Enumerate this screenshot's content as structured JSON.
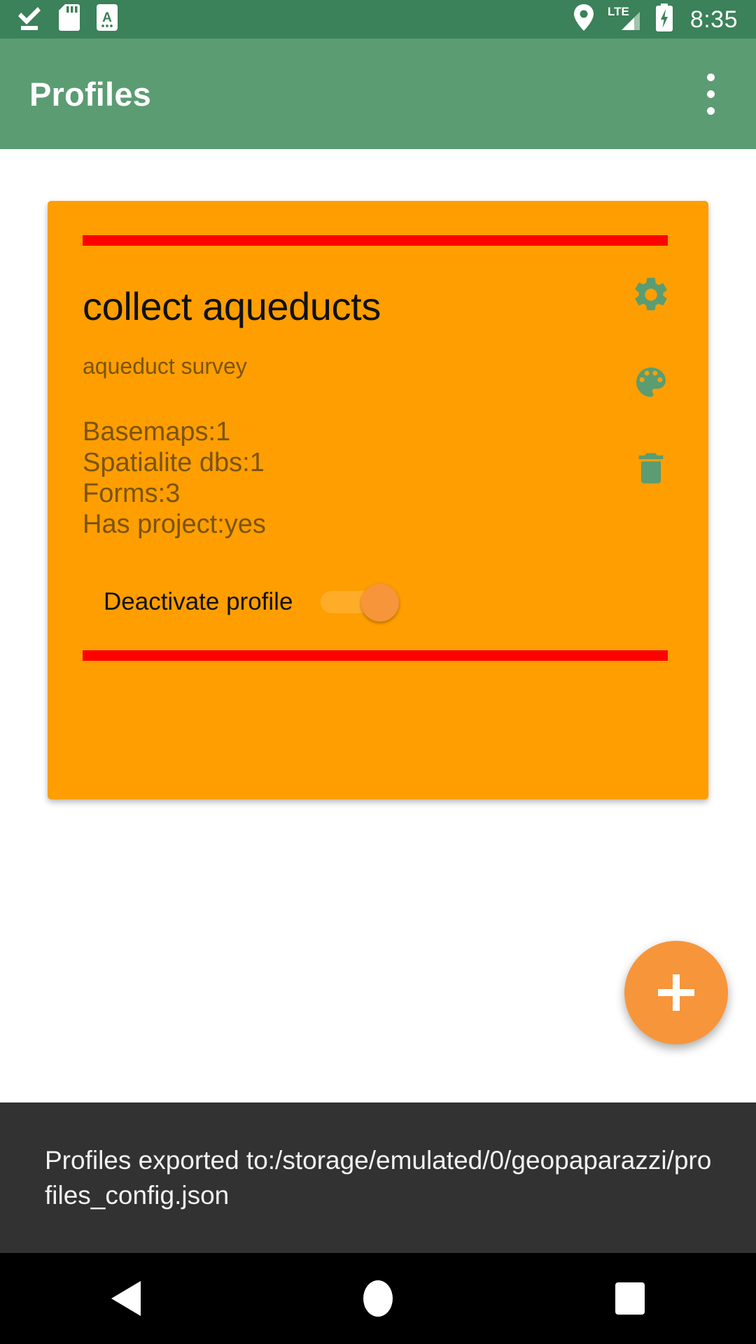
{
  "status_bar": {
    "background_color": "#3b8159",
    "left_icons": [
      {
        "name": "download-done-icon",
        "label": "download complete"
      },
      {
        "name": "sd-card-icon",
        "label": "SD card"
      },
      {
        "name": "input-method-icon",
        "label": "A"
      }
    ],
    "right_icons": [
      {
        "name": "location-pin-icon",
        "label": "location"
      },
      {
        "name": "lte-signal-icon",
        "label": "LTE"
      },
      {
        "name": "battery-charging-icon",
        "label": "charging"
      }
    ],
    "clock": "8:35"
  },
  "app_bar": {
    "title": "Profiles",
    "background_color": "#5b9c72",
    "overflow_menu_label": "More options"
  },
  "profile_card": {
    "background_color": "#FF9E00",
    "divider_color": "#FF0000",
    "title": "collect aqueducts",
    "subtitle": "aqueduct survey",
    "stats": [
      "Basemaps:1",
      "Spatialite dbs:1",
      "Forms:3",
      "Has project:yes"
    ],
    "actions": [
      {
        "name": "settings-icon",
        "label": "Profile settings"
      },
      {
        "name": "palette-icon",
        "label": "Profile color"
      },
      {
        "name": "trash-icon",
        "label": "Delete profile"
      }
    ],
    "toggle": {
      "label": "Deactivate profile",
      "state": "on",
      "thumb_color": "#F7953B"
    }
  },
  "fab": {
    "label": "Add profile",
    "icon": "plus-icon",
    "color": "#F7953B"
  },
  "snackbar": {
    "message": "Profiles exported to:/storage/emulated/0/geopaparazzi/profiles_config.json",
    "background_color": "#323232"
  },
  "nav_bar": {
    "buttons": [
      {
        "name": "nav-back-button",
        "label": "Back"
      },
      {
        "name": "nav-home-button",
        "label": "Home"
      },
      {
        "name": "nav-recents-button",
        "label": "Recents"
      }
    ]
  }
}
